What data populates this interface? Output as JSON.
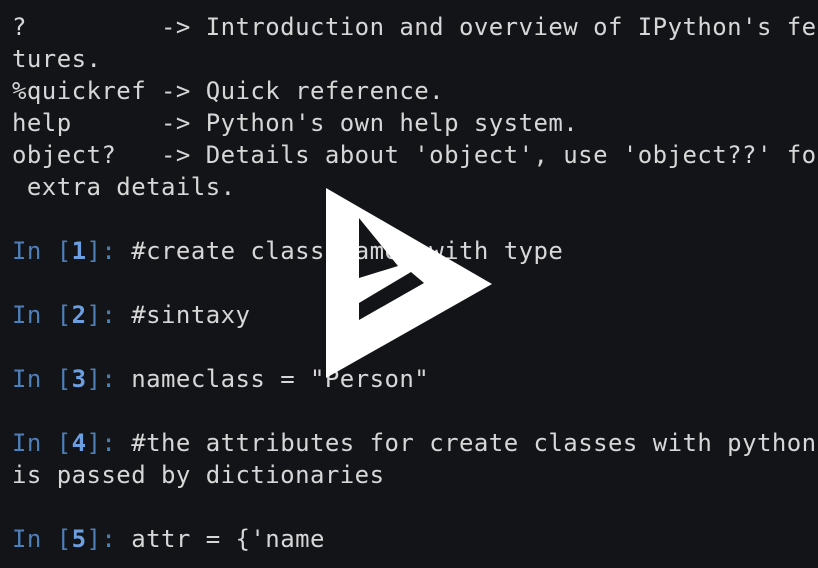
{
  "intro_lines": [
    "?         -> Introduction and overview of IPython's fea",
    "tures.",
    "%quickref -> Quick reference.",
    "help      -> Python's own help system.",
    "object?   -> Details about 'object', use 'object??' for",
    " extra details."
  ],
  "prompt": {
    "in_label": "In ",
    "open_bracket": "[",
    "close_bracket_colon": "]: "
  },
  "cells": [
    {
      "number": "1",
      "code": "#create class names with type",
      "continuation": ""
    },
    {
      "number": "2",
      "code": "#sintaxy",
      "continuation": ""
    },
    {
      "number": "3",
      "code": "nameclass = \"Person\"",
      "continuation": ""
    },
    {
      "number": "4",
      "code": "#the attributes for create classes with python",
      "continuation": "is passed by dictionaries"
    },
    {
      "number": "5",
      "code": "attr = {'name",
      "continuation": ""
    }
  ],
  "overlay": {
    "icon": "play-icon",
    "color": "#ffffff"
  },
  "colors": {
    "background": "#121417",
    "text": "#d7d7d7",
    "prompt": "#4f7fb9",
    "prompt_number": "#6d9fe0"
  }
}
